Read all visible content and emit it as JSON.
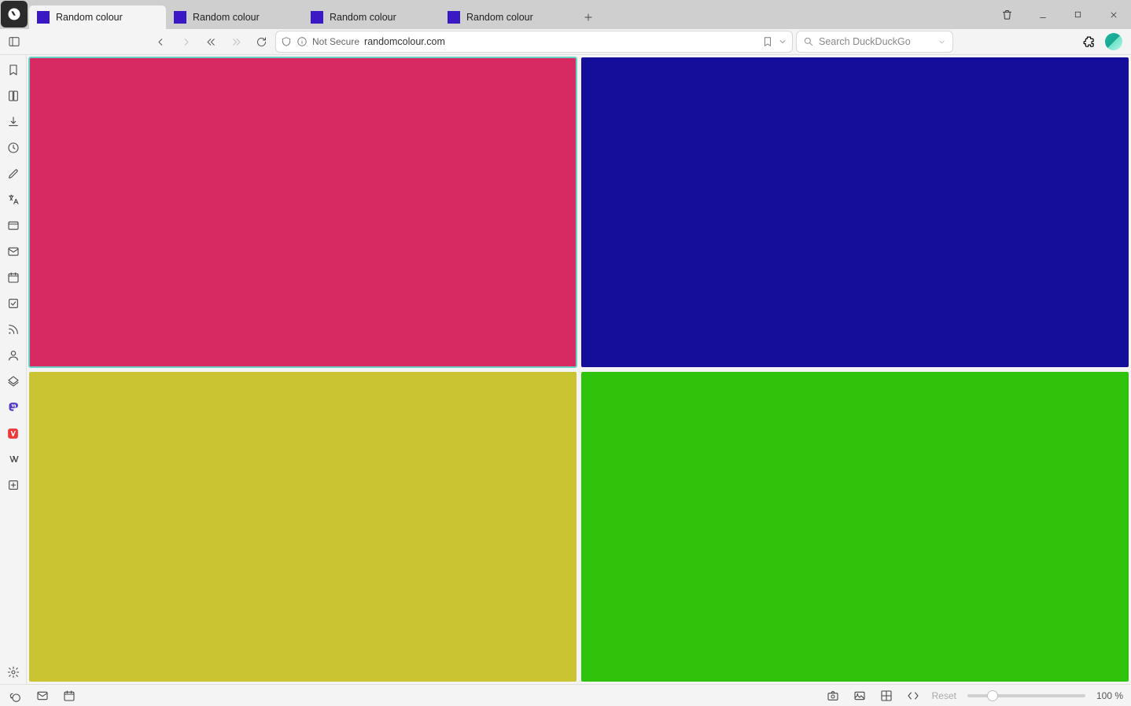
{
  "tabs": [
    {
      "title": "Random colour",
      "favicon_color": "#3a19c4",
      "active": true
    },
    {
      "title": "Random colour",
      "favicon_color": "#3a19c4",
      "active": false
    },
    {
      "title": "Random colour",
      "favicon_color": "#3a19c4",
      "active": false
    },
    {
      "title": "Random colour",
      "favicon_color": "#3a19c4",
      "active": false
    }
  ],
  "address_bar": {
    "not_secure_label": "Not Secure",
    "url": "randomcolour.com",
    "search_placeholder": "Search DuckDuckGo"
  },
  "tiles": [
    {
      "color": "#d72a63",
      "active": true
    },
    {
      "color": "#140e9a",
      "active": false
    },
    {
      "color": "#cac432",
      "active": false
    },
    {
      "color": "#2fc40b",
      "active": false
    }
  ],
  "status_bar": {
    "reset_label": "Reset",
    "zoom_label": "100 %"
  }
}
